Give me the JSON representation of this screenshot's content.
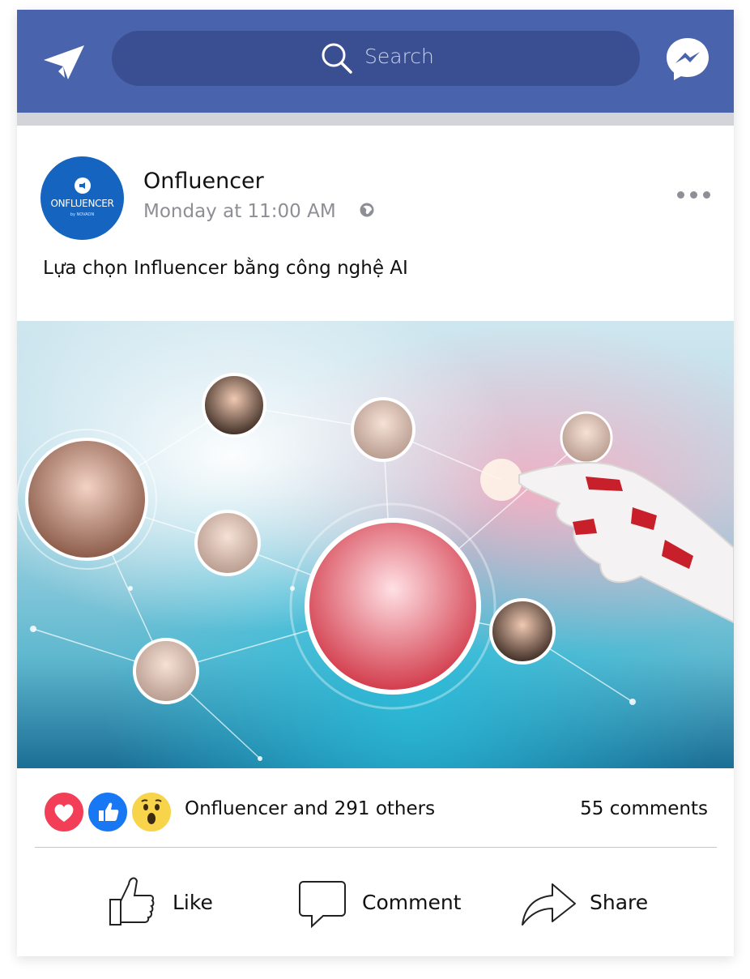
{
  "topbar": {
    "search_placeholder": "Search",
    "left_icon": "send-icon",
    "right_icon": "messenger-icon",
    "color": "#4a63ad"
  },
  "post": {
    "page_name": "Onfluencer",
    "avatar_text": "ONFLUENCER",
    "avatar_subtext": "by NOVAON",
    "timestamp": "Monday at 11:00 AM",
    "privacy_icon": "globe-icon",
    "caption": "Lựa chọn Influencer bằng công nghệ AI",
    "image_description_icon": "post-image"
  },
  "engagement": {
    "reactions": [
      "love",
      "like",
      "wow"
    ],
    "reactions_text": "Onfluencer and  291 others",
    "comments": "55 comments"
  },
  "actions": [
    {
      "label": "Like",
      "icon": "thumbs-up-icon"
    },
    {
      "label": "Comment",
      "icon": "comment-icon"
    },
    {
      "label": "Share",
      "icon": "share-icon"
    }
  ],
  "colors": {
    "brand_blue": "#4a63ad",
    "avatar_blue": "#1565c0",
    "love_red": "#f33e58",
    "like_blue": "#1877f2",
    "wow_yellow": "#f7d44a"
  }
}
